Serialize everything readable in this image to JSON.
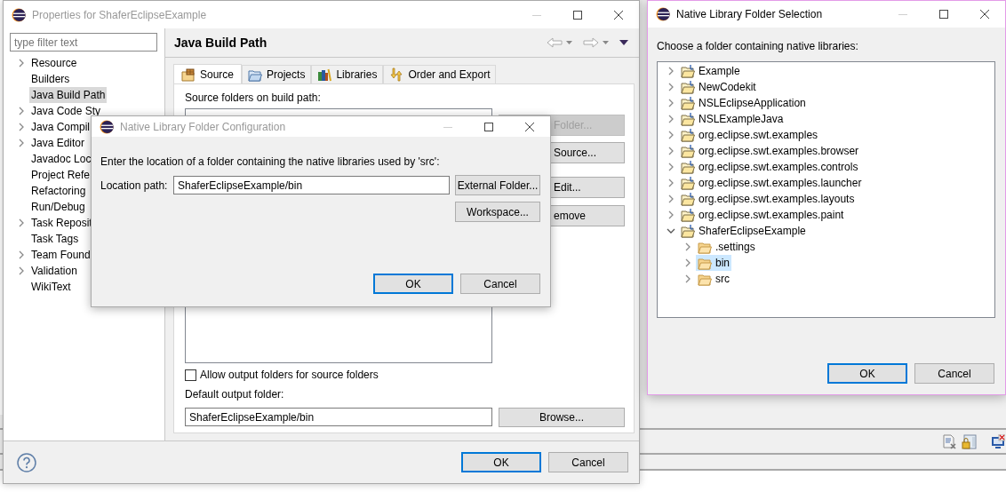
{
  "properties_window": {
    "title": "Properties for ShaferEclipseExample",
    "active": false,
    "filter": {
      "placeholder": "type filter text"
    },
    "categories": [
      {
        "label": "Resource",
        "kind": "branch",
        "selected": false
      },
      {
        "label": "Builders",
        "kind": "leaf",
        "selected": false
      },
      {
        "label": "Java Build Path",
        "kind": "leaf",
        "selected": true
      },
      {
        "label": "Java Code Sty",
        "kind": "branch",
        "selected": false
      },
      {
        "label": "Java Compil",
        "kind": "branch",
        "selected": false
      },
      {
        "label": "Java Editor",
        "kind": "branch",
        "selected": false
      },
      {
        "label": "Javadoc Loc",
        "kind": "leaf",
        "selected": false
      },
      {
        "label": "Project Refe",
        "kind": "leaf",
        "selected": false
      },
      {
        "label": "Refactoring",
        "kind": "leaf",
        "selected": false
      },
      {
        "label": "Run/Debug",
        "kind": "leaf",
        "selected": false
      },
      {
        "label": "Task Reposit",
        "kind": "branch",
        "selected": false
      },
      {
        "label": "Task Tags",
        "kind": "leaf",
        "selected": false
      },
      {
        "label": "Team Found",
        "kind": "branch",
        "selected": false
      },
      {
        "label": "Validation",
        "kind": "branch",
        "selected": false
      },
      {
        "label": "WikiText",
        "kind": "leaf",
        "selected": false
      }
    ],
    "page_title": "Java Build Path",
    "tabs": [
      {
        "label": "Source",
        "kind": "source",
        "selected": true
      },
      {
        "label": "Projects",
        "kind": "projects",
        "selected": false
      },
      {
        "label": "Libraries",
        "kind": "libraries",
        "selected": false
      },
      {
        "label": "Order and Export",
        "kind": "order",
        "selected": false
      }
    ],
    "source_label": "Source folders on build path:",
    "side_buttons": [
      {
        "label": "Folder...",
        "disabled": true
      },
      {
        "label": "Source...",
        "disabled": false
      },
      {
        "label": "Edit...",
        "disabled": false
      },
      {
        "label": "emove",
        "disabled": false
      }
    ],
    "allow_output": {
      "label": "Allow output folders for source folders",
      "checked": false
    },
    "output_label": "Default output folder:",
    "output_field": {
      "value": "ShaferEclipseExample/bin"
    },
    "browse_button": "Browse...",
    "buttons": [
      {
        "label": "OK",
        "default": true
      },
      {
        "label": "Cancel",
        "default": false
      }
    ]
  },
  "config_dialog": {
    "title": "Native Library Folder Configuration",
    "active": false,
    "prompt": "Enter the location of a folder containing the native libraries used by 'src':",
    "location_label": "Location path:",
    "location_field": {
      "value": "ShaferEclipseExample/bin"
    },
    "side_buttons": [
      "External Folder...",
      "Workspace..."
    ],
    "buttons": [
      {
        "label": "OK",
        "default": true
      },
      {
        "label": "Cancel",
        "default": false
      }
    ]
  },
  "selection_window": {
    "title": "Native Library Folder Selection",
    "active": true,
    "prompt": "Choose a folder containing native libraries:",
    "tree": [
      {
        "label": "Example",
        "kind": "project",
        "expanded": false,
        "selected": false
      },
      {
        "label": "NewCodekit",
        "kind": "project",
        "expanded": false,
        "selected": false
      },
      {
        "label": "NSLEclipseApplication",
        "kind": "project",
        "expanded": false,
        "selected": false
      },
      {
        "label": "NSLExampleJava",
        "kind": "project",
        "expanded": false,
        "selected": false
      },
      {
        "label": "org.eclipse.swt.examples",
        "kind": "project",
        "expanded": false,
        "selected": false
      },
      {
        "label": "org.eclipse.swt.examples.browser",
        "kind": "project",
        "expanded": false,
        "selected": false
      },
      {
        "label": "org.eclipse.swt.examples.controls",
        "kind": "project",
        "expanded": false,
        "selected": false
      },
      {
        "label": "org.eclipse.swt.examples.launcher",
        "kind": "project",
        "expanded": false,
        "selected": false
      },
      {
        "label": "org.eclipse.swt.examples.layouts",
        "kind": "project",
        "expanded": false,
        "selected": false
      },
      {
        "label": "org.eclipse.swt.examples.paint",
        "kind": "project",
        "expanded": false,
        "selected": false
      },
      {
        "label": "ShaferEclipseExample",
        "kind": "project",
        "expanded": true,
        "selected": false,
        "children": [
          {
            "label": ".settings",
            "kind": "folder",
            "expanded": false,
            "selected": false
          },
          {
            "label": "bin",
            "kind": "folder",
            "expanded": false,
            "selected": true
          },
          {
            "label": "src",
            "kind": "folder",
            "expanded": false,
            "selected": false
          }
        ]
      }
    ],
    "buttons": [
      {
        "label": "OK",
        "default": true
      },
      {
        "label": "Cancel",
        "default": false
      }
    ]
  }
}
